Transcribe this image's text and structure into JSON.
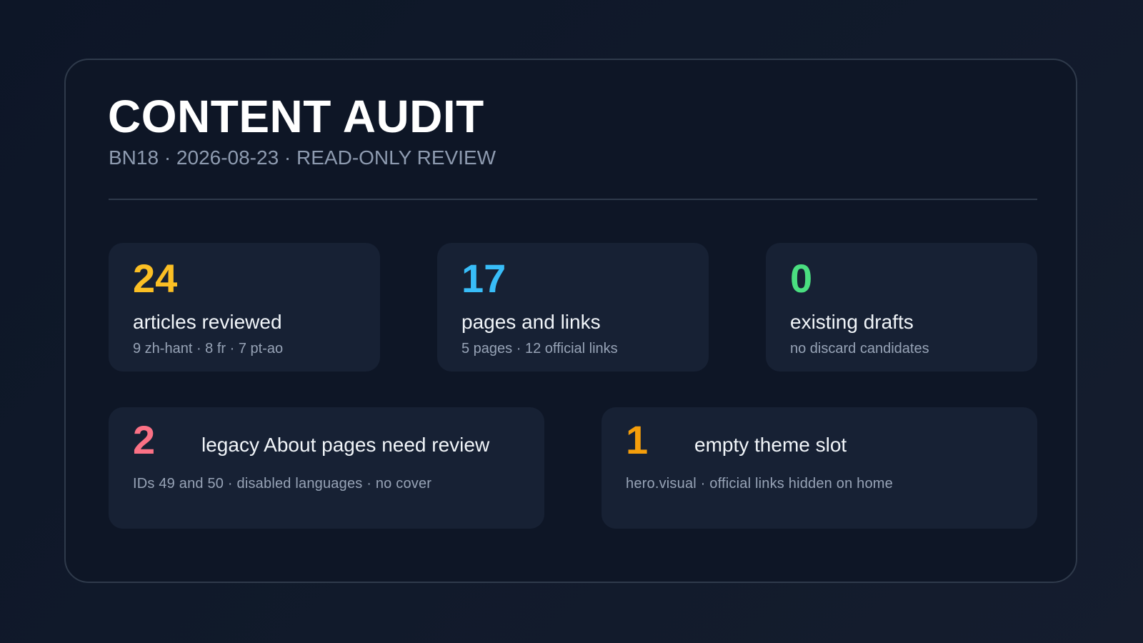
{
  "header": {
    "title": "CONTENT AUDIT",
    "subtitle": "BN18 · 2026-08-23 · READ-ONLY REVIEW"
  },
  "stats": [
    {
      "value": "24",
      "label": "articles reviewed",
      "detail": "9 zh-hant · 8 fr · 7 pt-ao",
      "color": "#fbbf24"
    },
    {
      "value": "17",
      "label": "pages and links",
      "detail": "5 pages · 12 official links",
      "color": "#38bdf8"
    },
    {
      "value": "0",
      "label": "existing drafts",
      "detail": "no discard candidates",
      "color": "#4ade80"
    }
  ],
  "issues": [
    {
      "value": "2",
      "label": "legacy About pages need review",
      "detail": "IDs 49 and 50 · disabled languages · no cover",
      "color": "#fb7185"
    },
    {
      "value": "1",
      "label": "empty theme slot",
      "detail": "hero.visual · official links hidden on home",
      "color": "#f59e0b"
    }
  ],
  "colors": {
    "background": "#0e1626",
    "card": "#172134",
    "panel_border": "#2f3a4b",
    "muted_text": "#8e9bb0"
  }
}
